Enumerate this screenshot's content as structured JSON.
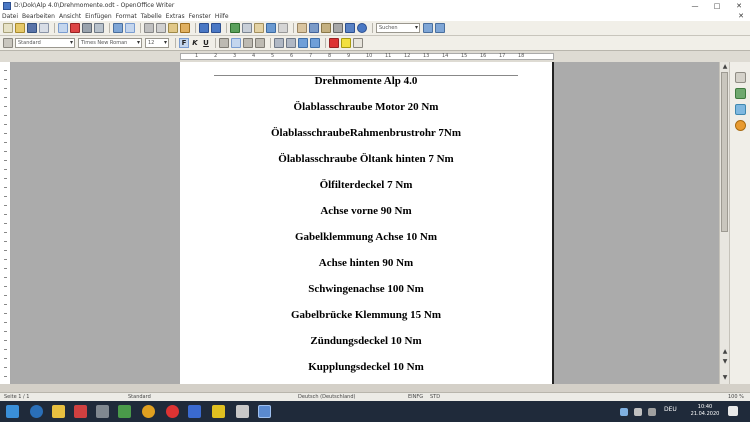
{
  "window": {
    "title": "D:\\Dok\\Alp 4.0\\Drehmomente.odt - OpenOffice Writer",
    "minimize": "—",
    "maximize": "□",
    "close": "✕"
  },
  "menu": {
    "items": [
      "Datei",
      "Bearbeiten",
      "Ansicht",
      "Einfügen",
      "Format",
      "Tabelle",
      "Extras",
      "Fenster",
      "Hilfe"
    ],
    "doc_close": "✕"
  },
  "toolbar": {
    "search_placeholder": "Suchen",
    "style_value": "Standard",
    "font_value": "Times New Roman",
    "size_value": "12",
    "bold": "F",
    "italic": "K",
    "underline": "U"
  },
  "ruler": {
    "marks": [
      "1",
      "2",
      "3",
      "4",
      "5",
      "6",
      "7",
      "8",
      "9",
      "10",
      "11",
      "12",
      "13",
      "14",
      "15",
      "16",
      "17",
      "18"
    ]
  },
  "document": {
    "lines": [
      "Drehmomente Alp 4.0",
      "Ölablasschraube  Motor 20 Nm",
      "ÖlablasschraubeRahmenbrustrohr 7Nm",
      "Ölablasschraube Öltank hinten 7 Nm",
      "Ölfilterdeckel 7 Nm",
      "Achse vorne 90 Nm",
      "Gabelklemmung Achse 10 Nm",
      "Achse hinten 90 Nm",
      "Schwingenachse 100 Nm",
      "Gabelbrücke Klemmung 15 Nm",
      "Zündungsdeckel 10 Nm",
      "Kupplungsdeckel 10 Nm"
    ]
  },
  "status": {
    "page": "Seite 1 / 1",
    "style": "Standard",
    "language": "Deutsch (Deutschland)",
    "mode": "EINFG",
    "std": "STD",
    "zoom": "100 %"
  },
  "taskbar": {
    "lang": "DEU",
    "time": "10:40",
    "date": "21.04.2020"
  },
  "colors": {
    "taskbar": "#1f2a3a",
    "workspace": "#ababab",
    "accent": "#4a78c4"
  }
}
